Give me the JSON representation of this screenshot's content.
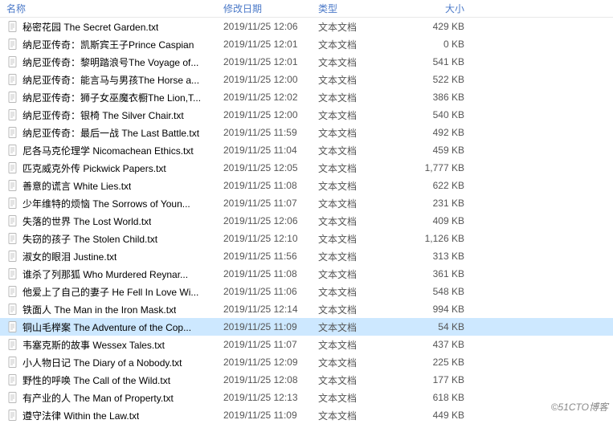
{
  "columns": {
    "name": "名称",
    "date": "修改日期",
    "type": "类型",
    "size": "大小"
  },
  "type_label": "文本文档",
  "selected_index": 17,
  "files": [
    {
      "name": "秘密花园 The Secret Garden.txt",
      "date": "2019/11/25 12:06",
      "size": "429 KB"
    },
    {
      "name": "纳尼亚传奇：凯斯宾王子Prince Caspian",
      "date": "2019/11/25 12:01",
      "size": "0 KB"
    },
    {
      "name": "纳尼亚传奇：黎明踏浪号The Voyage of...",
      "date": "2019/11/25 12:01",
      "size": "541 KB"
    },
    {
      "name": "纳尼亚传奇：能言马与男孩The Horse a...",
      "date": "2019/11/25 12:00",
      "size": "522 KB"
    },
    {
      "name": "纳尼亚传奇：狮子女巫魔衣橱The Lion,T...",
      "date": "2019/11/25 12:02",
      "size": "386 KB"
    },
    {
      "name": "纳尼亚传奇：银椅 The Silver Chair.txt",
      "date": "2019/11/25 12:00",
      "size": "540 KB"
    },
    {
      "name": "纳尼亚传奇：最后一战 The Last Battle.txt",
      "date": "2019/11/25 11:59",
      "size": "492 KB"
    },
    {
      "name": "尼各马克伦理学 Nicomachean Ethics.txt",
      "date": "2019/11/25 11:04",
      "size": "459 KB"
    },
    {
      "name": "匹克威克外传 Pickwick Papers.txt",
      "date": "2019/11/25 12:05",
      "size": "1,777 KB"
    },
    {
      "name": "善意的谎言 White Lies.txt",
      "date": "2019/11/25 11:08",
      "size": "622 KB"
    },
    {
      "name": "少年维特的烦恼 The Sorrows of Youn...",
      "date": "2019/11/25 11:07",
      "size": "231 KB"
    },
    {
      "name": "失落的世界 The Lost World.txt",
      "date": "2019/11/25 12:06",
      "size": "409 KB"
    },
    {
      "name": "失窃的孩子 The Stolen Child.txt",
      "date": "2019/11/25 12:10",
      "size": "1,126 KB"
    },
    {
      "name": "淑女的眼泪 Justine.txt",
      "date": "2019/11/25 11:56",
      "size": "313 KB"
    },
    {
      "name": "谁杀了列那狐 Who Murdered Reynar...",
      "date": "2019/11/25 11:08",
      "size": "361 KB"
    },
    {
      "name": "他爱上了自己的妻子 He Fell In Love Wi...",
      "date": "2019/11/25 11:06",
      "size": "548 KB"
    },
    {
      "name": "铁面人 The Man in the Iron Mask.txt",
      "date": "2019/11/25 12:14",
      "size": "994 KB"
    },
    {
      "name": "铜山毛榉案 The Adventure of the Cop...",
      "date": "2019/11/25 11:09",
      "size": "54 KB"
    },
    {
      "name": "韦塞克斯的故事 Wessex Tales.txt",
      "date": "2019/11/25 11:07",
      "size": "437 KB"
    },
    {
      "name": "小人物日记 The Diary of a Nobody.txt",
      "date": "2019/11/25 12:09",
      "size": "225 KB"
    },
    {
      "name": "野性的呼唤 The Call of the Wild.txt",
      "date": "2019/11/25 12:08",
      "size": "177 KB"
    },
    {
      "name": "有产业的人 The Man of Property.txt",
      "date": "2019/11/25 12:13",
      "size": "618 KB"
    },
    {
      "name": "遵守法律 Within the Law.txt",
      "date": "2019/11/25 11:09",
      "size": "449 KB"
    }
  ],
  "watermark": "©51CTO博客"
}
